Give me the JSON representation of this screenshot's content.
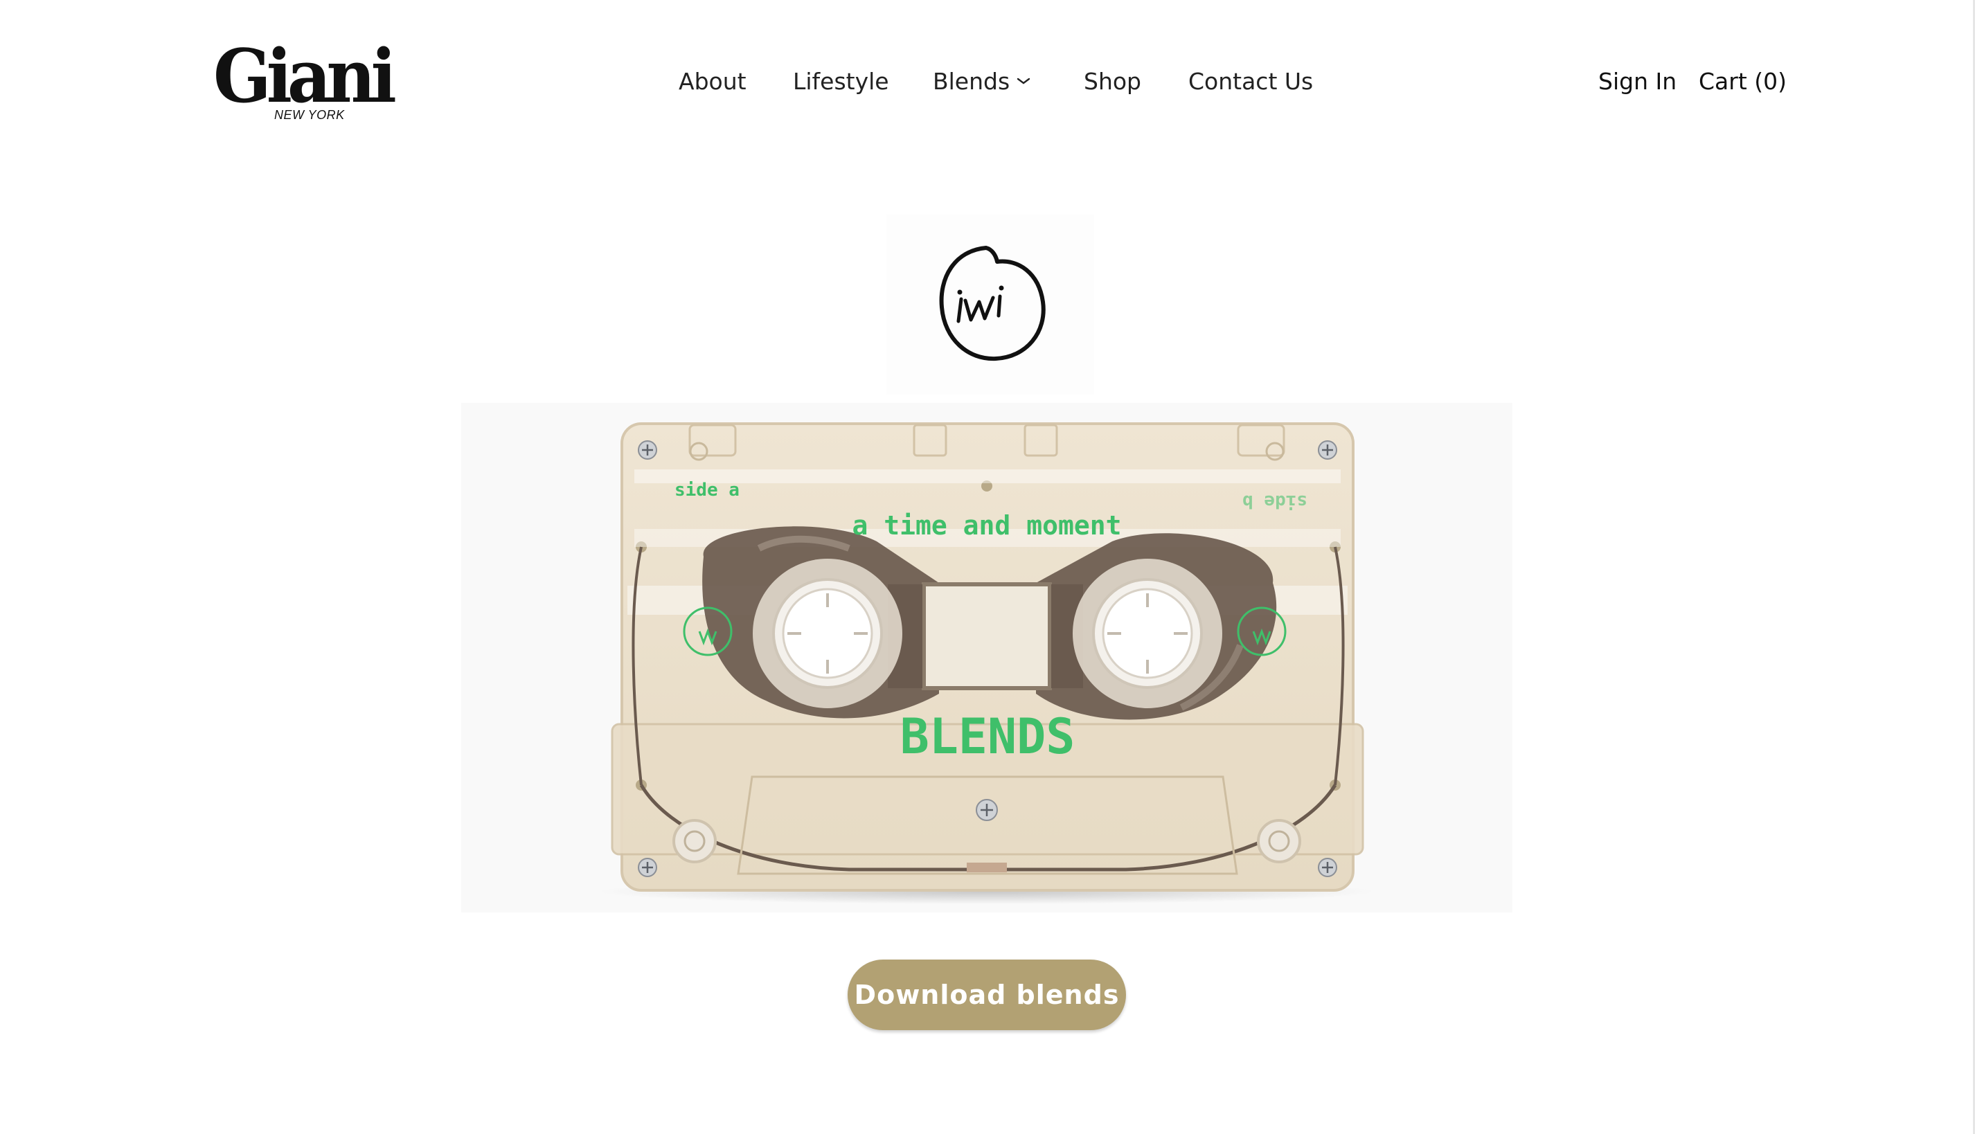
{
  "brand": {
    "logo_text": "Giani",
    "logo_subtext": "NEW YORK"
  },
  "nav": {
    "items": [
      {
        "label": "About"
      },
      {
        "label": "Lifestyle"
      },
      {
        "label": "Blends"
      },
      {
        "label": "Shop"
      },
      {
        "label": "Contact Us"
      }
    ],
    "sign_in": "Sign In",
    "cart": "Cart (0)"
  },
  "hero": {
    "cassette": {
      "side_a": "side a",
      "side_b": "side b",
      "title": "a time and moment",
      "brand_label": "BLENDS"
    },
    "download_button": "Download blends"
  },
  "colors": {
    "accent": "#b2a173",
    "label_green": "#3fbf6a",
    "cassette_shell": "#e9dfcc",
    "tape_brown": "#6a5a4e"
  },
  "icons": [
    "chevron-down-icon",
    "iwi-badge-icon"
  ]
}
